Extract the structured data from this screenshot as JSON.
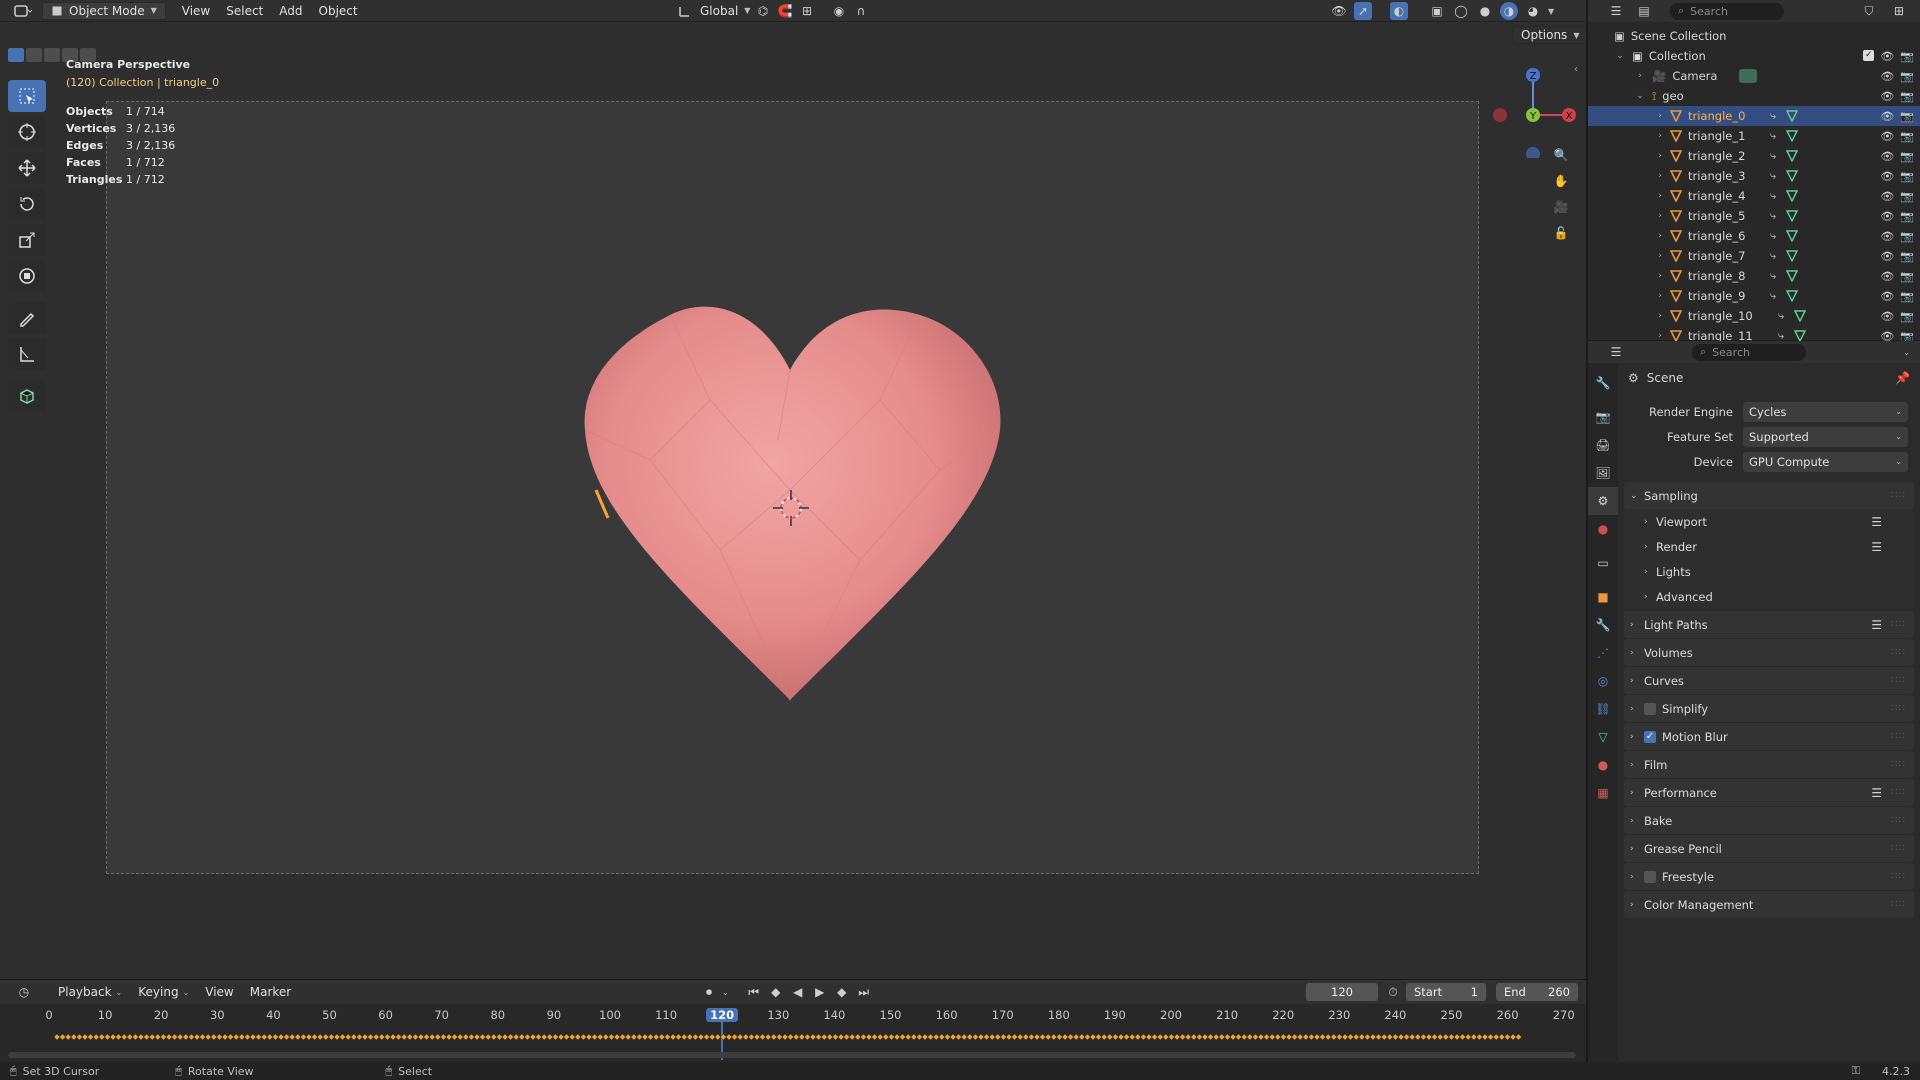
{
  "header": {
    "mode": "Object Mode",
    "menus": [
      "View",
      "Select",
      "Add",
      "Object"
    ],
    "transform_orientation": "Global",
    "options_label": "Options"
  },
  "viewport": {
    "view_name": "Camera Perspective",
    "collection_line": "(120) Collection | triangle_0",
    "stats": [
      {
        "key": "Objects",
        "value": "1 / 714"
      },
      {
        "key": "Vertices",
        "value": "3 / 2,136"
      },
      {
        "key": "Edges",
        "value": "3 / 2,136"
      },
      {
        "key": "Faces",
        "value": "1 / 712"
      },
      {
        "key": "Triangles",
        "value": "1 / 712"
      }
    ],
    "gizmo": {
      "x": "X",
      "y": "Y",
      "z": "Z"
    },
    "heart_color": "#e58c8c",
    "selection_color": "#ffa033"
  },
  "outliner": {
    "search_placeholder": "Search",
    "scene_collection": "Scene Collection",
    "collection": "Collection",
    "camera": "Camera",
    "geo": "geo",
    "objects": [
      "triangle_0",
      "triangle_1",
      "triangle_2",
      "triangle_3",
      "triangle_4",
      "triangle_5",
      "triangle_6",
      "triangle_7",
      "triangle_8",
      "triangle_9",
      "triangle_10",
      "triangle_11"
    ]
  },
  "properties": {
    "search_placeholder": "Search",
    "context": "Scene",
    "fields": [
      {
        "label": "Render Engine",
        "value": "Cycles"
      },
      {
        "label": "Feature Set",
        "value": "Supported"
      },
      {
        "label": "Device",
        "value": "GPU Compute"
      }
    ],
    "sampling": "Sampling",
    "sampling_sub": [
      "Viewport",
      "Render",
      "Lights",
      "Advanced"
    ],
    "panels": {
      "light_paths": "Light Paths",
      "volumes": "Volumes",
      "curves": "Curves",
      "simplify": "Simplify",
      "motion_blur": "Motion Blur",
      "film": "Film",
      "performance": "Performance",
      "bake": "Bake",
      "grease_pencil": "Grease Pencil",
      "freestyle": "Freestyle",
      "color_management": "Color Management"
    }
  },
  "timeline": {
    "menus": [
      "Playback",
      "Keying",
      "View",
      "Marker"
    ],
    "current_frame": "120",
    "start_label": "Start",
    "start_value": "1",
    "end_label": "End",
    "end_value": "260",
    "ticks": [
      "0",
      "10",
      "20",
      "30",
      "40",
      "50",
      "60",
      "70",
      "80",
      "90",
      "100",
      "110",
      "120",
      "130",
      "140",
      "150",
      "160",
      "170",
      "180",
      "190",
      "200",
      "210",
      "220",
      "230",
      "240",
      "250",
      "260",
      "270"
    ]
  },
  "statusbar": {
    "left": "Set 3D Cursor",
    "middle": "Rotate View",
    "right": "Select",
    "version": "4.2.3"
  },
  "colors": {
    "accent": "#4772b3",
    "selection_row": "#334d80",
    "active_text": "#ffb14a"
  }
}
